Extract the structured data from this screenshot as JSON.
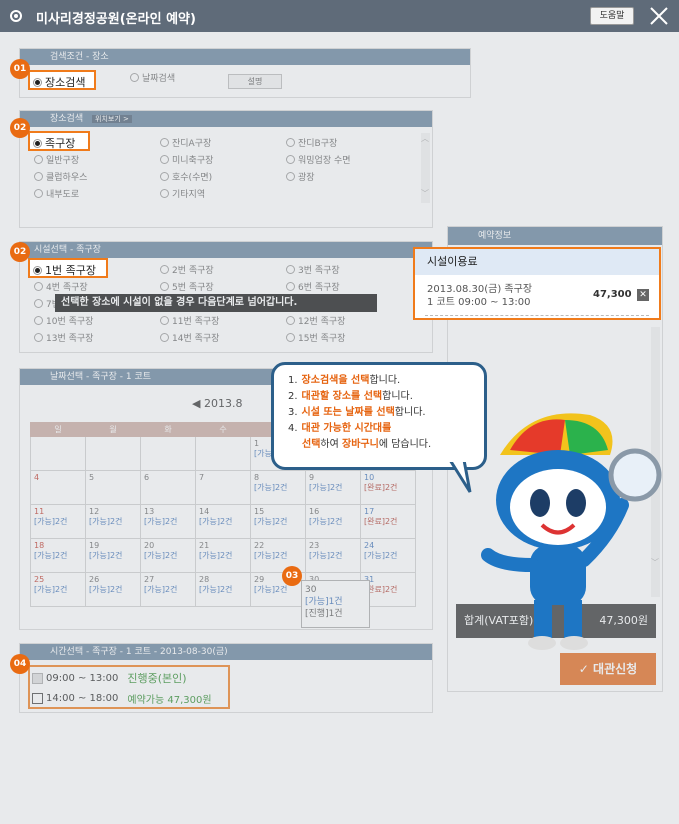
{
  "window": {
    "title": "미사리경정공원(온라인 예약)",
    "help_label": "도움말"
  },
  "search_condition": {
    "header": "검색조건  - 장소",
    "options": [
      {
        "label": "장소검색",
        "checked": true
      },
      {
        "label": "날짜검색",
        "checked": false
      }
    ],
    "button": "설명"
  },
  "place_search": {
    "header": "장소검색",
    "location_button": "위치보기 >",
    "items": [
      {
        "label": "족구장",
        "checked": true
      },
      {
        "label": "잔디A구장"
      },
      {
        "label": "잔디B구장"
      },
      {
        "label": "일반구장"
      },
      {
        "label": "미니축구장"
      },
      {
        "label": "워밍업장 수면"
      },
      {
        "label": "클럽하우스"
      },
      {
        "label": "호수(수면)"
      },
      {
        "label": "광장"
      },
      {
        "label": "내부도로"
      },
      {
        "label": "기타지역"
      }
    ]
  },
  "facility_select": {
    "header": "시설선택 - 족구장",
    "items": [
      {
        "label": "1번 족구장",
        "checked": true
      },
      {
        "label": "2번 족구장"
      },
      {
        "label": "3번 족구장"
      },
      {
        "label": "4번 족구장"
      },
      {
        "label": "5번 족구장"
      },
      {
        "label": "6번 족구장"
      },
      {
        "label": "7번 족구장"
      },
      {
        "label": "8번 족구장"
      },
      {
        "label": "9번 족구장"
      },
      {
        "label": "10번 족구장"
      },
      {
        "label": "11번 족구장"
      },
      {
        "label": "12번 족구장"
      },
      {
        "label": "13번 족구장"
      },
      {
        "label": "14번 족구장"
      },
      {
        "label": "15번 족구장"
      }
    ],
    "tooltip": "선택한 장소에 시설이 없을 경우 다음단계로 넘어갑니다."
  },
  "date_select": {
    "header": "날짜선택 - 족구장 - 1 코트",
    "month": "2013.8",
    "weekdays": [
      "일",
      "월",
      "화",
      "수",
      "목",
      "금",
      "토"
    ],
    "weeks": [
      [
        {
          "d": ""
        },
        {
          "d": ""
        },
        {
          "d": ""
        },
        {
          "d": ""
        },
        {
          "d": "1",
          "s": "[가능]2건",
          "t": "a"
        },
        {
          "d": "2",
          "s": "[가능]2건",
          "t": "a"
        },
        {
          "d": "3",
          "s": "[완료]2건",
          "t": "c"
        }
      ],
      [
        {
          "d": "4"
        },
        {
          "d": "5"
        },
        {
          "d": "6"
        },
        {
          "d": "7"
        },
        {
          "d": "8",
          "s": "[가능]2건",
          "t": "a"
        },
        {
          "d": "9",
          "s": "[가능]2건",
          "t": "a"
        },
        {
          "d": "10",
          "s": "[완료]2건",
          "t": "c"
        }
      ],
      [
        {
          "d": "11",
          "s": "[가능]2건",
          "t": "a"
        },
        {
          "d": "12",
          "s": "[가능]2건",
          "t": "a"
        },
        {
          "d": "13",
          "s": "[가능]2건",
          "t": "a"
        },
        {
          "d": "14",
          "s": "[가능]2건",
          "t": "a"
        },
        {
          "d": "15",
          "s": "[가능]2건",
          "t": "a"
        },
        {
          "d": "16",
          "s": "[가능]2건",
          "t": "a"
        },
        {
          "d": "17",
          "s": "[완료]2건",
          "t": "c"
        }
      ],
      [
        {
          "d": "18",
          "s": "[가능]2건",
          "t": "a"
        },
        {
          "d": "19",
          "s": "[가능]2건",
          "t": "a"
        },
        {
          "d": "20",
          "s": "[가능]2건",
          "t": "a"
        },
        {
          "d": "21",
          "s": "[가능]2건",
          "t": "a"
        },
        {
          "d": "22",
          "s": "[가능]2건",
          "t": "a"
        },
        {
          "d": "23",
          "s": "[가능]2건",
          "t": "a"
        },
        {
          "d": "24",
          "s": "[가능]2건",
          "t": "a"
        }
      ],
      [
        {
          "d": "25",
          "s": "[가능]2건",
          "t": "a"
        },
        {
          "d": "26",
          "s": "[가능]2건",
          "t": "a"
        },
        {
          "d": "27",
          "s": "[가능]2건",
          "t": "a"
        },
        {
          "d": "28",
          "s": "[가능]2건",
          "t": "a"
        },
        {
          "d": "29",
          "s": "[가능]2건",
          "t": "a"
        },
        {
          "d": "30"
        },
        {
          "d": "31",
          "s": "[완료]2건",
          "t": "c"
        }
      ]
    ],
    "selected": {
      "day": "30",
      "line1": "[가능]1건",
      "line2": "[진행]1건"
    }
  },
  "time_select": {
    "header": "시간선택 - 족구장 - 1 코트 - 2013-08-30(금)",
    "slots": [
      {
        "time": "09:00 ~ 13:00",
        "status": "진행중(본인)"
      },
      {
        "time": "14:00 ~ 18:00",
        "status": "예약가능 47,300원"
      }
    ]
  },
  "reservation": {
    "header": "예약정보",
    "fee_title": "시설이용료",
    "item_line1": "2013.08.30(금) 족구장",
    "item_line2": "1 코트 09:00 ~ 13:00",
    "item_price": "47,300",
    "total_label": "합계(VAT포함)",
    "total_value": "47,300원",
    "apply_label": "대관신청"
  },
  "guide": {
    "steps": [
      {
        "n": "1.",
        "hl": "장소검색을 선택",
        "rest": "합니다."
      },
      {
        "n": "2.",
        "hl": "대관할 장소를 선택",
        "rest": "합니다."
      },
      {
        "n": "3.",
        "hl": "시설 또는 날짜를 선택",
        "rest": "합니다."
      },
      {
        "n": "4.",
        "hl": "대관 가능한 시간대를",
        "rest": ""
      }
    ],
    "line5_hl1": "선택",
    "line5_mid": "하여 ",
    "line5_hl2": "장바구니",
    "line5_rest": "에 담습니다."
  },
  "badges": [
    "01",
    "02",
    "02",
    "03",
    "04"
  ],
  "colors": {
    "accent": "#f07b1b",
    "header": "#64819c",
    "titlebar": "#5f6b79"
  }
}
